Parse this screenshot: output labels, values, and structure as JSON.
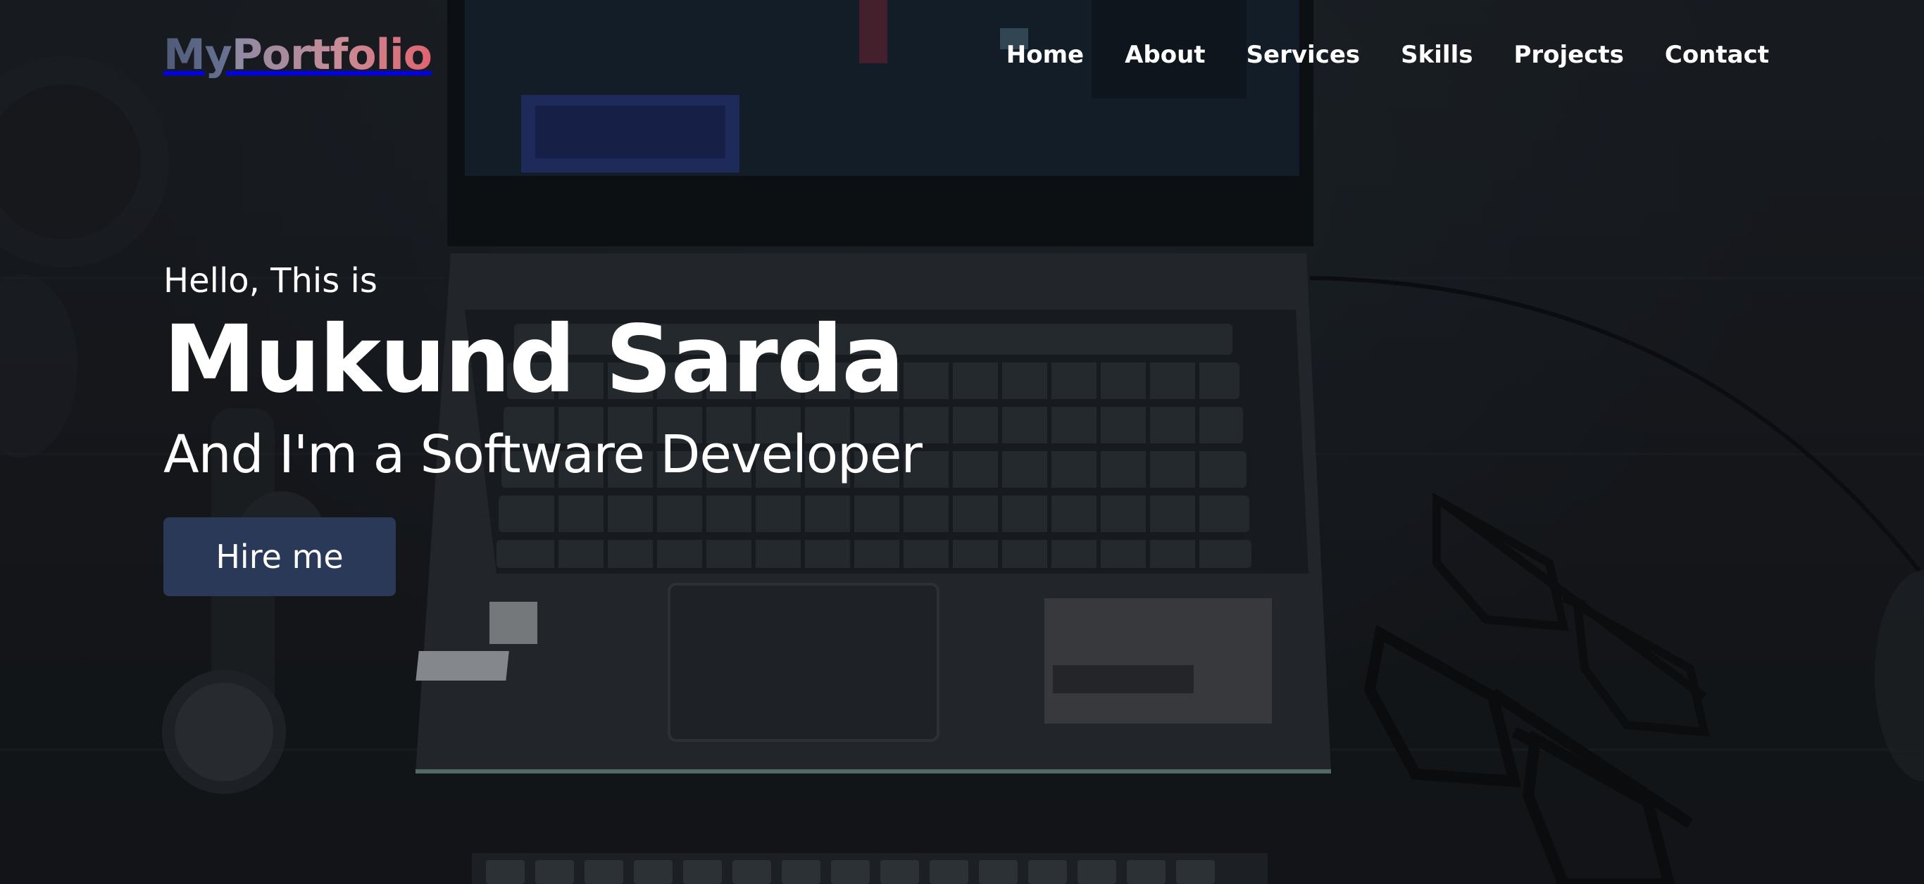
{
  "header": {
    "logo_part_my": "My",
    "logo_part_portfolio": "Portfolio",
    "nav": {
      "home": "Home",
      "about": "About",
      "services": "Services",
      "skills": "Skills",
      "projects": "Projects",
      "contact": "Contact"
    }
  },
  "hero": {
    "greeting": "Hello, This is",
    "name": "Mukund Sarda",
    "role": "And I'm a Software Developer",
    "cta_label": "Hire me"
  },
  "colors": {
    "button_bg": "#2b3959",
    "logo_start": "#4e5a78",
    "logo_end": "#e0646f",
    "text": "#ffffff",
    "background": "#1b1e22"
  }
}
